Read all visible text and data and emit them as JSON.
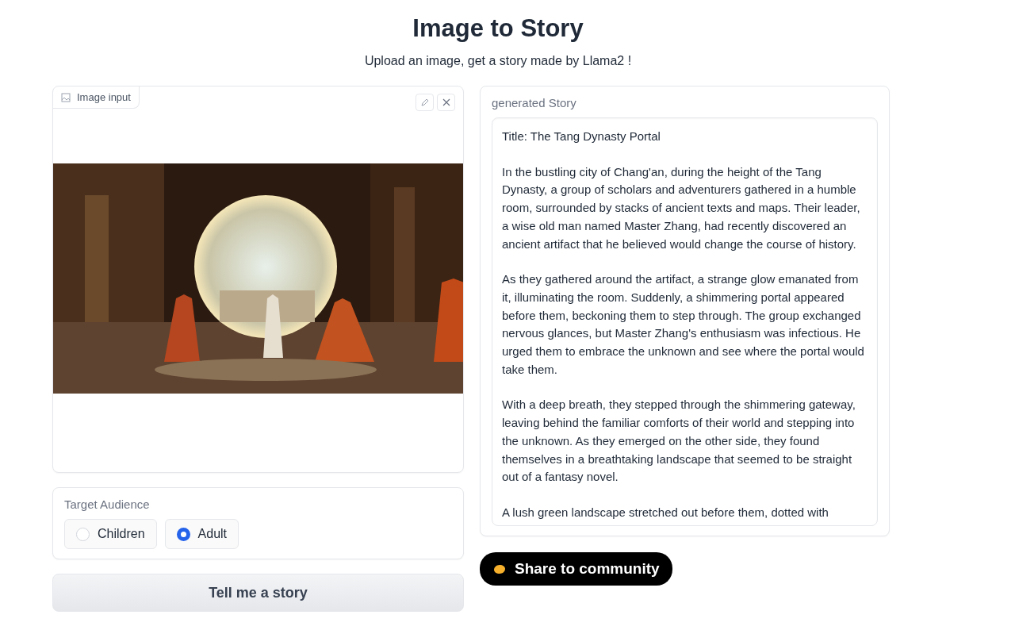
{
  "title": "Image to Story",
  "subtitle": "Upload an image, get a story made by Llama2 !",
  "image_input": {
    "label": "Image input"
  },
  "audience": {
    "label": "Target Audience",
    "options": [
      {
        "label": "Children",
        "selected": false
      },
      {
        "label": "Adult",
        "selected": true
      }
    ]
  },
  "submit_button": "Tell me a story",
  "story": {
    "label": "generated Story",
    "paragraphs": [
      "Title: The Tang Dynasty Portal",
      "In the bustling city of Chang'an, during the height of the Tang Dynasty, a group of scholars and adventurers gathered in a humble room, surrounded by stacks of ancient texts and maps. Their leader, a wise old man named Master Zhang, had recently discovered an ancient artifact that he believed would change the course of history.",
      "As they gathered around the artifact, a strange glow emanated from it, illuminating the room. Suddenly, a shimmering portal appeared before them, beckoning them to step through. The group exchanged nervous glances, but Master Zhang's enthusiasm was infectious. He urged them to embrace the unknown and see where the portal would take them.",
      "With a deep breath, they stepped through the shimmering gateway, leaving behind the familiar comforts of their world and stepping into the unknown. As they emerged on the other side, they found themselves in a breathtaking landscape that seemed to be straight out of a fantasy novel.",
      "A lush green landscape stretched out before them, dotted with"
    ]
  },
  "share_button": "Share to community"
}
